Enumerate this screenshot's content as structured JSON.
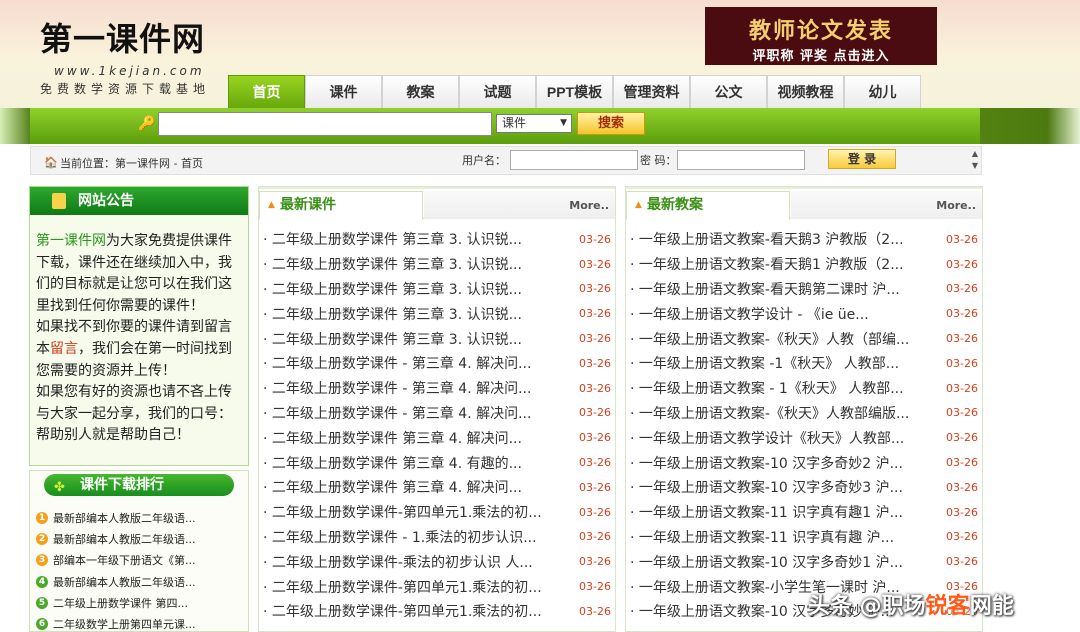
{
  "header": {
    "logo_title": "第一课件网",
    "logo_url": "www.1kejian.com",
    "logo_slogan": "免费数学资源下载基地",
    "banner_line1": "教师论文发表",
    "banner_line2": "评职称 评奖 点击进入"
  },
  "nav": {
    "tabs": [
      "首页",
      "课件",
      "教案",
      "试题",
      "PPT模板",
      "管理资料",
      "公文",
      "视频教程",
      "幼儿"
    ],
    "active": "首页"
  },
  "search": {
    "select_value": "课件",
    "button_label": "搜索"
  },
  "login": {
    "location": "当前位置：第一课件网 - 首页",
    "username_label": "用户名：",
    "password_label": "密 码：",
    "button_label": "登 录"
  },
  "notice": {
    "title": "网站公告",
    "link1": "第一课件网",
    "text1": "为大家免费提供课件下载，课件还在继续加入中，我们的目标就是让您可以在我们这里找到任何你需要的课件！",
    "text2": "如果找不到你要的课件请到留言本",
    "link2": "留言",
    "text3": "，我们会在第一时间找到您需要的资源并上传！",
    "text4": "如果您有好的资源也请不吝上传与大家一起分享，我们的口号：帮助别人就是帮助自己！"
  },
  "rank": {
    "title": "课件下载排行",
    "items": [
      {
        "n": "1",
        "text": "最新部编本人教版二年级语...",
        "color": "#f5a01a"
      },
      {
        "n": "2",
        "text": "最新部编本人教版二年级语...",
        "color": "#f5a01a"
      },
      {
        "n": "3",
        "text": "部编本一年级下册语文《第...",
        "color": "#f5a01a"
      },
      {
        "n": "4",
        "text": "最新部编本人教版二年级语...",
        "color": "#4ba82a"
      },
      {
        "n": "5",
        "text": "二年级上册数学课件 第四...",
        "color": "#4ba82a"
      },
      {
        "n": "6",
        "text": "二年级数学上册第四单元课...",
        "color": "#4ba82a"
      }
    ]
  },
  "courseware": {
    "title": "最新课件",
    "more": "More..",
    "items": [
      {
        "t": "· 二年级上册数学课件 第三章 3. 认识锐...",
        "d": "03-26"
      },
      {
        "t": "· 二年级上册数学课件 第三章 3. 认识锐...",
        "d": "03-26"
      },
      {
        "t": "· 二年级上册数学课件 第三章 3. 认识锐...",
        "d": "03-26"
      },
      {
        "t": "· 二年级上册数学课件 第三章 3. 认识锐...",
        "d": "03-26"
      },
      {
        "t": "· 二年级上册数学课件 第三章 3. 认识锐...",
        "d": "03-26"
      },
      {
        "t": "· 二年级上册数学课件 - 第三章 4. 解决问...",
        "d": "03-26"
      },
      {
        "t": "· 二年级上册数学课件 - 第三章 4. 解决问...",
        "d": "03-26"
      },
      {
        "t": "· 二年级上册数学课件 - 第三章 4. 解决问...",
        "d": "03-26"
      },
      {
        "t": "· 二年级上册数学课件 第三章 4. 解决问...",
        "d": "03-26"
      },
      {
        "t": "· 二年级上册数学课件 第三章 4. 有趣的...",
        "d": "03-26"
      },
      {
        "t": "· 二年级上册数学课件 第三章 4. 解决问...",
        "d": "03-26"
      },
      {
        "t": "· 二年级上册数学课件-第四单元1.乘法的初...",
        "d": "03-26"
      },
      {
        "t": "· 二年级上册数学课件 - 1.乘法的初步认识...",
        "d": "03-26"
      },
      {
        "t": "· 二年级上册数学课件-乘法的初步认识 人...",
        "d": "03-26"
      },
      {
        "t": "· 二年级上册数学课件-第四单元1.乘法的初...",
        "d": "03-26"
      },
      {
        "t": "· 二年级上册数学课件-第四单元1.乘法的初...",
        "d": "03-26"
      }
    ]
  },
  "lessonplans": {
    "title": "最新教案",
    "more": "More..",
    "items": [
      {
        "t": "· 一年级上册语文教案-看天鹅3 沪教版（2...",
        "d": "03-26"
      },
      {
        "t": "· 一年级上册语文教案-看天鹅1 沪教版（2...",
        "d": "03-26"
      },
      {
        "t": "· 一年级上册语文教案-看天鹅第二课时 沪...",
        "d": "03-26"
      },
      {
        "t": "· 一年级上册语文教学设计 - 《ie üe...",
        "d": "03-26"
      },
      {
        "t": "· 一年级上册语文教案-《秋天》人教（部编...",
        "d": "03-26"
      },
      {
        "t": "· 一年级上册语文教案 -1《秋天》 人教部...",
        "d": "03-26"
      },
      {
        "t": "· 一年级上册语文教案 - 1《秋天》 人教部...",
        "d": "03-26"
      },
      {
        "t": "· 一年级上册语文教案-《秋天》人教部编版...",
        "d": "03-26"
      },
      {
        "t": "· 一年级上册语文教学设计《秋天》人教部...",
        "d": "03-26"
      },
      {
        "t": "· 一年级上册语文教案-10 汉字多奇妙2 沪...",
        "d": "03-26"
      },
      {
        "t": "· 一年级上册语文教案-10 汉字多奇妙3 沪...",
        "d": "03-26"
      },
      {
        "t": "· 一年级上册语文教案-11 识字真有趣1 沪...",
        "d": "03-26"
      },
      {
        "t": "· 一年级上册语文教案-11 识字真有趣 沪...",
        "d": "03-26"
      },
      {
        "t": "· 一年级上册语文教案-10 汉字多奇妙1 沪...",
        "d": "03-26"
      },
      {
        "t": "· 一年级上册语文教案-小学生笔一课时 沪...",
        "d": "03-26"
      },
      {
        "t": "· 一年级上册语文教案-10 汉字多奇妙 沪...",
        "d": "03-26"
      }
    ]
  },
  "watermark": {
    "prefix": "头条 @职场",
    "highlight": "锐客",
    "suffix": "网能"
  }
}
